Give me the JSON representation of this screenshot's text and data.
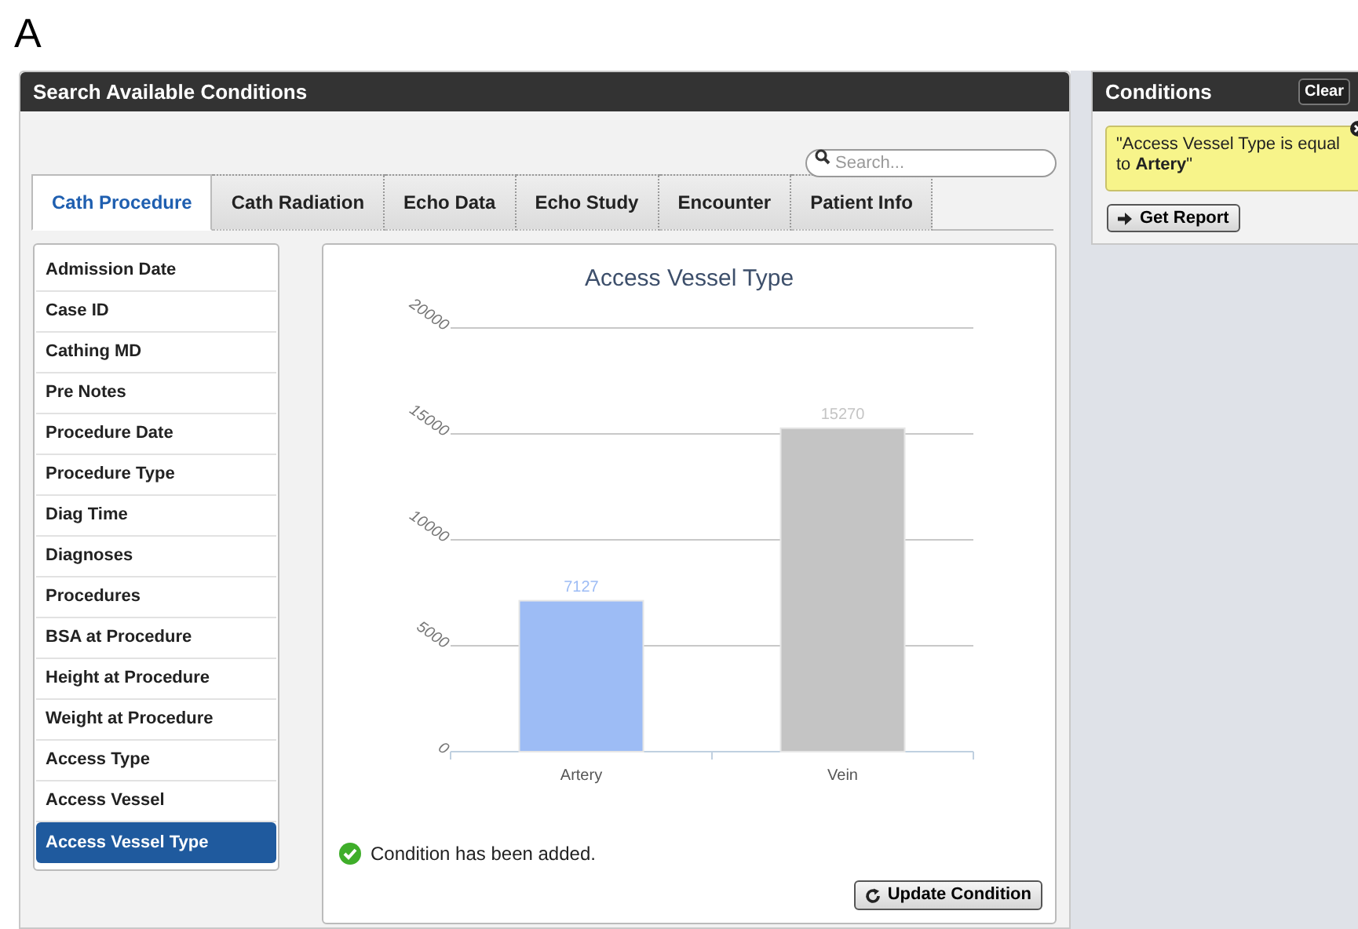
{
  "figure_label": "A",
  "search_panel": {
    "title": "Search Available Conditions",
    "search": {
      "placeholder": "Search..."
    },
    "tabs": [
      {
        "label": "Cath Procedure",
        "selected": true
      },
      {
        "label": "Cath Radiation",
        "selected": false
      },
      {
        "label": "Echo Data",
        "selected": false
      },
      {
        "label": "Echo Study",
        "selected": false
      },
      {
        "label": "Encounter",
        "selected": false
      },
      {
        "label": "Patient Info",
        "selected": false
      }
    ],
    "fields": [
      {
        "label": "Admission Date",
        "selected": false
      },
      {
        "label": "Case ID",
        "selected": false
      },
      {
        "label": "Cathing MD",
        "selected": false
      },
      {
        "label": "Pre Notes",
        "selected": false
      },
      {
        "label": "Procedure Date",
        "selected": false
      },
      {
        "label": "Procedure Type",
        "selected": false
      },
      {
        "label": "Diag Time",
        "selected": false
      },
      {
        "label": "Diagnoses",
        "selected": false
      },
      {
        "label": "Procedures",
        "selected": false
      },
      {
        "label": "BSA at Procedure",
        "selected": false
      },
      {
        "label": "Height at Procedure",
        "selected": false
      },
      {
        "label": "Weight at Procedure",
        "selected": false
      },
      {
        "label": "Access Type",
        "selected": false
      },
      {
        "label": "Access Vessel",
        "selected": false
      },
      {
        "label": "Access Vessel Type",
        "selected": true
      }
    ],
    "chart_data": {
      "type": "bar",
      "title": "Access Vessel Type",
      "categories": [
        "Artery",
        "Vein"
      ],
      "series": [
        {
          "color": "#9dbcf5",
          "values": [
            7127,
            null
          ]
        },
        {
          "color": "#c4c4c4",
          "values": [
            null,
            15270
          ]
        }
      ],
      "ylim": [
        0,
        20000
      ],
      "grid": true,
      "yticks": [
        0,
        5000,
        10000,
        15000,
        20000
      ],
      "data_labels": true
    },
    "message": "Condition has been added.",
    "update_button": "Update Condition"
  },
  "conditions_panel": {
    "title": "Conditions",
    "clear_button": "Clear",
    "conditions": [
      {
        "text": "\"Access Vessel Type is equal to **Artery**\""
      }
    ],
    "report_button": "Get Report"
  }
}
